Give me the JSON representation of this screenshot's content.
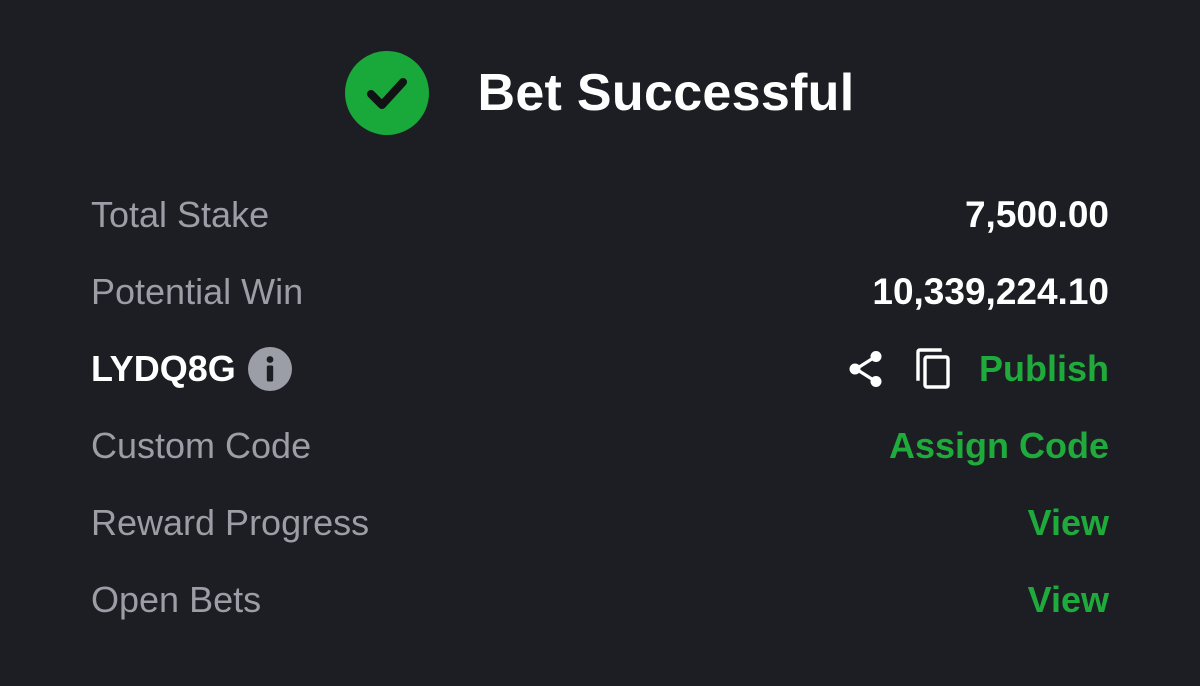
{
  "header": {
    "title": "Bet Successful",
    "icon": "check-circle-icon",
    "icon_color": "#19a83a"
  },
  "summary": {
    "total_stake_label": "Total Stake",
    "total_stake_value": "7,500.00",
    "potential_win_label": "Potential Win",
    "potential_win_value": "10,339,224.10"
  },
  "booking": {
    "code": "LYDQ8G",
    "info_icon": "info-icon",
    "share_icon": "share-icon",
    "copy_icon": "copy-icon",
    "publish_label": "Publish"
  },
  "custom_code": {
    "label": "Custom Code",
    "action_label": "Assign Code"
  },
  "reward_progress": {
    "label": "Reward Progress",
    "action_label": "View"
  },
  "open_bets": {
    "label": "Open Bets",
    "action_label": "View"
  },
  "colors": {
    "background": "#1d1e23",
    "accent": "#1eab3b",
    "muted_text": "#9b9ea6",
    "primary_text": "#ffffff"
  }
}
